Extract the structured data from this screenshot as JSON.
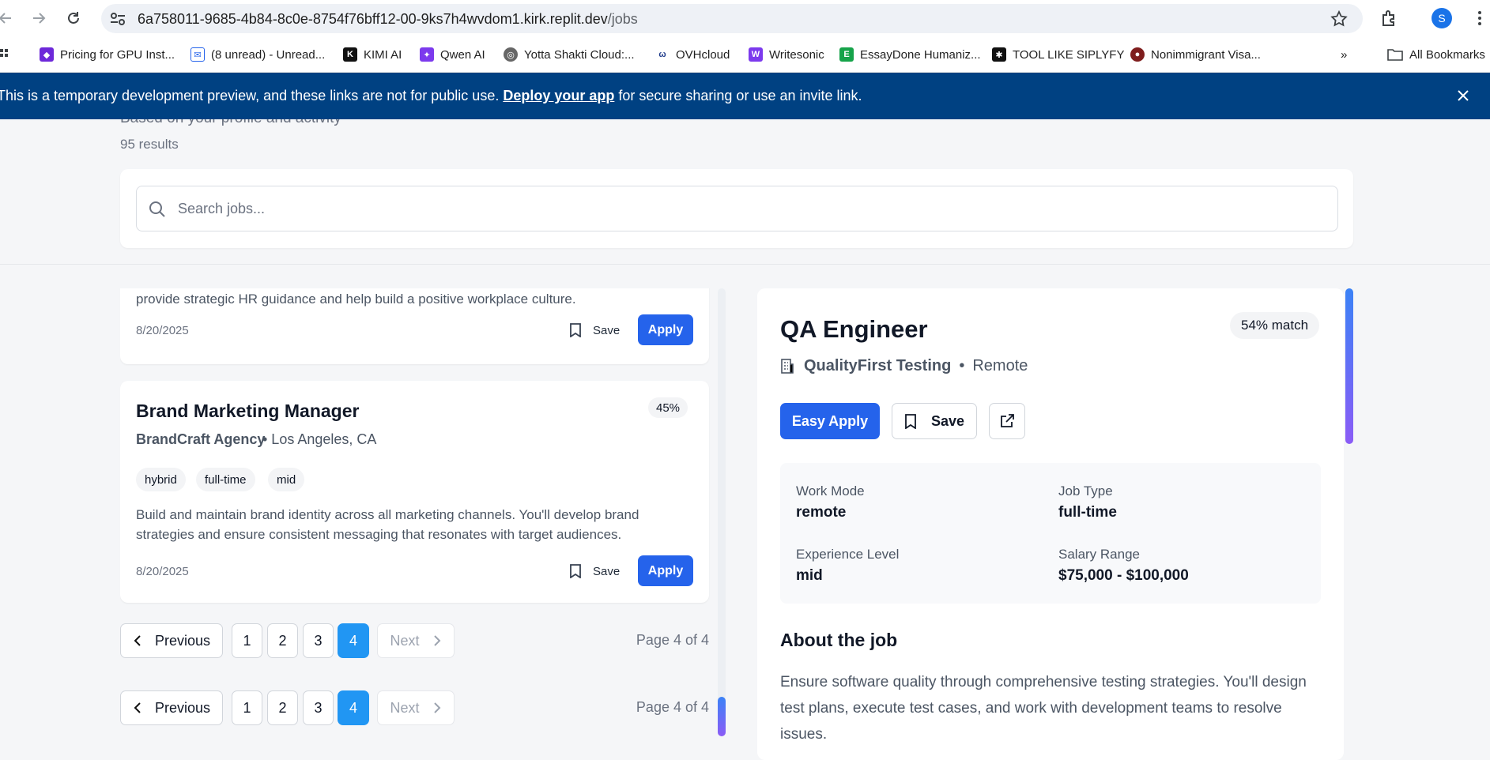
{
  "browser": {
    "url_host": "6a758011-9685-4b84-8c0e-8754f76bff12-00-9ks7h4wvdom1.kirk.replit.dev",
    "url_path": "/jobs",
    "profile_initial": "S"
  },
  "bookmarks": [
    {
      "label": "Pricing for GPU Inst...",
      "icon": "gpu-icon",
      "color": "#6d28d9"
    },
    {
      "label": "(8 unread) - Unread...",
      "icon": "mail-icon",
      "color": "#2563eb"
    },
    {
      "label": "KIMI AI",
      "icon": "kimi-icon",
      "color": "#111111"
    },
    {
      "label": "Qwen AI",
      "icon": "qwen-icon",
      "color": "#7c3aed"
    },
    {
      "label": "Yotta Shakti Cloud:...",
      "icon": "globe-icon",
      "color": "#555555"
    },
    {
      "label": "OVHcloud",
      "icon": "ovh-icon",
      "color": "#1e3a8a"
    },
    {
      "label": "Writesonic",
      "icon": "writesonic-icon",
      "color": "#7c3aed"
    },
    {
      "label": "EssayDone Humaniz...",
      "icon": "essaydone-icon",
      "color": "#16a34a"
    },
    {
      "label": "TOOL LIKE SIPLYFY",
      "icon": "tool-icon",
      "color": "#111111"
    },
    {
      "label": "Nonimmigrant Visa...",
      "icon": "seal-icon",
      "color": "#7f1d1d"
    }
  ],
  "bookmarks_all": "All Bookmarks",
  "banner": {
    "text_before": "This is a temporary development preview, and these links are not for public use. ",
    "link": "Deploy your app",
    "text_after": " for secure sharing or use an invite link."
  },
  "header": {
    "subtitle": "Based on your profile and activity",
    "results": "95 results"
  },
  "search": {
    "placeholder": "Search jobs..."
  },
  "job_list": {
    "card1": {
      "description": "provide strategic HR guidance and help build a positive workplace culture.",
      "date": "8/20/2025",
      "save_label": "Save",
      "apply_label": "Apply"
    },
    "card2": {
      "title": "Brand Marketing Manager",
      "company": "BrandCraft Agency",
      "location": "• Los Angeles, CA",
      "match": "45%",
      "tags": [
        "hybrid",
        "full-time",
        "mid"
      ],
      "description": "Build and maintain brand identity across all marketing channels. You'll develop brand strategies and ensure consistent messaging that resonates with target audiences.",
      "date": "8/20/2025",
      "save_label": "Save",
      "apply_label": "Apply"
    }
  },
  "pagination": {
    "previous": "Previous",
    "next": "Next",
    "pages": [
      "1",
      "2",
      "3",
      "4"
    ],
    "current": "4",
    "info": "Page 4 of 4"
  },
  "detail": {
    "title": "QA Engineer",
    "match": "54% match",
    "company": "QualityFirst Testing",
    "location": "Remote",
    "easy_apply": "Easy Apply",
    "save": "Save",
    "info": [
      {
        "label": "Work Mode",
        "value": "remote"
      },
      {
        "label": "Job Type",
        "value": "full-time"
      },
      {
        "label": "Experience Level",
        "value": "mid"
      },
      {
        "label": "Salary Range",
        "value": "$75,000 - $100,000"
      }
    ],
    "about_heading": "About the job",
    "about_text": "Ensure software quality through comprehensive testing strategies. You'll design test plans, execute test cases, and work with development teams to resolve issues."
  },
  "colors": {
    "primary": "#2563eb",
    "active_page": "#2196f3",
    "banner": "#004182",
    "scroll_gradient_start": "#3b82f6",
    "scroll_gradient_end": "#8b5cf6"
  }
}
